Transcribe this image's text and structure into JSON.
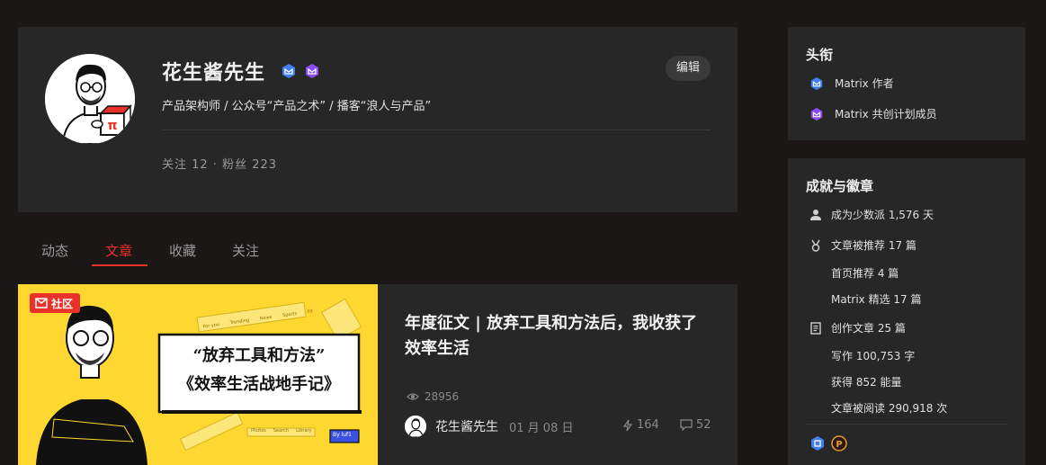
{
  "profile": {
    "name": "花生酱先生",
    "edit_label": "编辑",
    "bio": "产品架构师 / 公众号“产品之术” / 播客“浪人与产品”",
    "follow_stats": "关注 12 · 粉丝 223"
  },
  "tabs": [
    {
      "label": "动态",
      "active": false
    },
    {
      "label": "文章",
      "active": true
    },
    {
      "label": "收藏",
      "active": false
    },
    {
      "label": "关注",
      "active": false
    }
  ],
  "article": {
    "cover": {
      "tag": "社区",
      "line1": "“放弃工具和方法”",
      "line2": "《效率生活战地手记》",
      "chips": [
        "For you",
        "Trending",
        "News",
        "Sports",
        "Fit"
      ],
      "search_chips": [
        "Photos",
        "Search",
        "Library"
      ],
      "button": "By luf1"
    },
    "title": "年度征文 | 放弃工具和方法后，我收获了效率生活",
    "views": "28956",
    "author": "花生酱先生",
    "date": "01 月 08 日",
    "charge_count": "164",
    "comment_count": "52"
  },
  "sidebar": {
    "titles": {
      "heading": "头衔",
      "items": [
        {
          "label": "Matrix 作者",
          "color": "#3f7ff0"
        },
        {
          "label": "Matrix 共创计划成员",
          "color": "#8a4df0"
        }
      ]
    },
    "achievements": {
      "heading": "成就与徽章",
      "minority_days": "成为少数派 1,576 天",
      "recommended": "文章被推荐 17 篇",
      "home_recommend": "首页推荐 4 篇",
      "matrix_featured": "Matrix 精选 17 篇",
      "articles_written": "创作文章 25 篇",
      "words": "写作 100,753 字",
      "energy": "获得 852 能量",
      "reads": "文章被阅读 290,918 次"
    }
  },
  "colors": {
    "accent": "#e8322a",
    "author_badge": "#3f7ff0",
    "cocreate_badge": "#8a4df0",
    "cover_bg": "#fed730"
  }
}
